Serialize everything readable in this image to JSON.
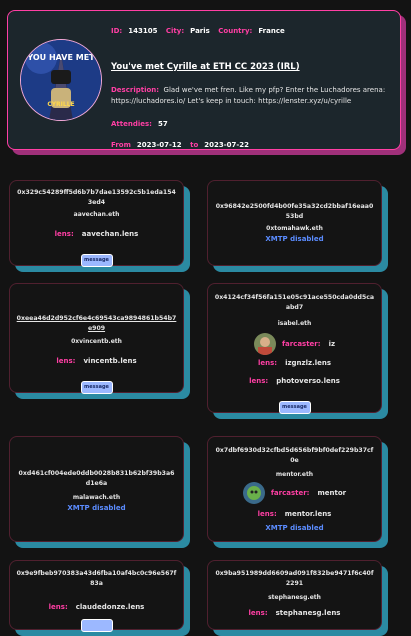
{
  "event": {
    "id_label": "ID:",
    "id": "143105",
    "city_label": "City:",
    "city": "Paris",
    "country_label": "Country:",
    "country": "France",
    "title": "You've met Cyrille at ETH CC 2023 (IRL)",
    "description_label": "Description:",
    "description": "Glad we've met fren. Like my pfp? Enter the Luchadores arena: https://luchadores.io/ Let's keep in touch: https://lenster.xyz/u/cyrille",
    "attendees_label": "Attendies:",
    "attendees": "57",
    "from_label": "From",
    "from": "2023-07-12",
    "to_label": "to",
    "to": "2023-07-22",
    "logo_text_top": "YOU HAVE MET",
    "logo_text_bottom": "CYRILLE"
  },
  "cards": [
    {
      "address": "0x329c54289ff5d6b7b7dae13592c5b1eda1543ed4",
      "ens": "aavechan.eth",
      "lens_label": "lens:",
      "lens": "aavechan.lens",
      "button": "message"
    },
    {
      "address": "0x96842e2500fd4b00fe35a32cd2bbaf16eaa053bd",
      "ens": "0xtomahawk.eth",
      "xmtp": "XMTP disabled"
    },
    {
      "address": "0xeea46d2d952cf6e4c69543ca9894861b54b7e909",
      "ens": "0xvincentb.eth",
      "lens_label": "lens:",
      "lens": "vincentb.lens",
      "button": "message"
    },
    {
      "address": "0x4124cf34f56fa151e05c91ace550cda0dd5caabd7",
      "ens": "isabel.eth",
      "farcaster_label": "farcaster:",
      "farcaster": "iz",
      "lens_label": "lens:",
      "lens": "izgnzlz.lens",
      "lens2_label": "lens:",
      "lens2": "photoverso.lens",
      "button": "message"
    },
    {
      "address": "0xd461cf004ede0ddb0028b831b62bf39b3a6d1e6a",
      "ens": "malawach.eth",
      "xmtp": "XMTP disabled"
    },
    {
      "address": "0x7dbf6930d32cfbd5d656bf9bf0def229b37cf0e",
      "ens": "mentor.eth",
      "farcaster_label": "farcaster:",
      "farcaster": "mentor",
      "lens_label": "lens:",
      "lens": "mentor.lens",
      "xmtp": "XMTP disabled"
    },
    {
      "address": "0x9e9fbeb970383a43d6fba10af4bc0c96e567f83a",
      "lens_label": "lens:",
      "lens": "claudedonze.lens"
    },
    {
      "address": "0x9ba951989dd6609ad091f832be9471f6c40f2291",
      "ens": "stephanesg.eth",
      "lens_label": "lens:",
      "lens": "stephanesg.lens"
    }
  ],
  "colors": {
    "accent": "#ff3fa4",
    "card_shadow": "#2b8aa2",
    "button": "#9cb8ff",
    "xmtp": "#5b8cff"
  }
}
